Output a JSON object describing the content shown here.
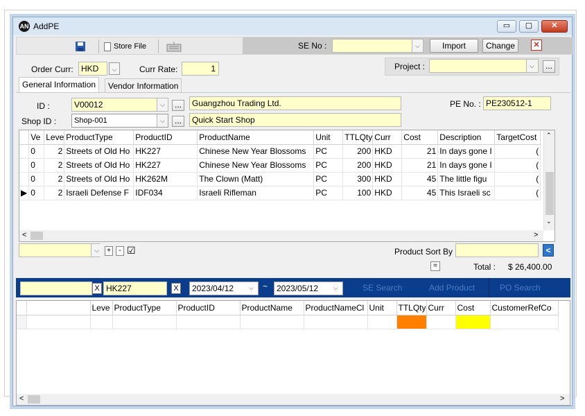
{
  "window": {
    "title": "AddPE",
    "icon_text": "AN",
    "minimize": "▭",
    "maximize": "▢",
    "close": "✕"
  },
  "toolbar": {
    "store_file_label": "Store File",
    "se_no_label": "SE No :",
    "se_no_value": "",
    "import_label": "Import",
    "change_label": "Change",
    "close_label": "✕"
  },
  "header": {
    "order_curr_label": "Order Curr:",
    "order_curr_value": "HKD",
    "curr_rate_label": "Curr Rate:",
    "curr_rate_value": "1",
    "project_label": "Project :",
    "project_value": "",
    "ellipsis": "..."
  },
  "tabs": [
    {
      "label": "General Information"
    },
    {
      "label": "Vendor Information"
    }
  ],
  "general": {
    "id_label": "ID :",
    "id_value": "V00012",
    "vendor_name": "Guangzhou Trading Ltd.",
    "pe_no_label": "PE No. :",
    "pe_no_value": "PE230512-1",
    "shop_id_label": "Shop ID :",
    "shop_id_value": "Shop-001",
    "shop_name": "Quick Start Shop"
  },
  "items_grid": {
    "columns": [
      "Ve",
      "Leve",
      "ProductType",
      "ProductID",
      "ProductName",
      "Unit",
      "TTLQty",
      "Curr",
      "Cost",
      "Description",
      "TargetCost"
    ],
    "rows": [
      {
        "marker": "",
        "ve": "0",
        "leve": "2",
        "type": "Streets of Old Ho",
        "id": "HK227",
        "name": "Chinese New Year Blossoms",
        "unit": "PC",
        "qty": "200",
        "curr": "HKD",
        "cost": "21",
        "desc": "In days gone I",
        "target": "("
      },
      {
        "marker": "",
        "ve": "0",
        "leve": "2",
        "type": "Streets of Old Ho",
        "id": "HK227",
        "name": "Chinese New Year Blossoms",
        "unit": "PC",
        "qty": "200",
        "curr": "HKD",
        "cost": "21",
        "desc": "In days gone I",
        "target": "("
      },
      {
        "marker": "",
        "ve": "0",
        "leve": "2",
        "type": "Streets of Old Ho",
        "id": "HK262M",
        "name": "The Clown (Matt)",
        "unit": "PC",
        "qty": "300",
        "curr": "HKD",
        "cost": "45",
        "desc": "The little figu",
        "target": "("
      },
      {
        "marker": "▶",
        "ve": "0",
        "leve": "2",
        "type": "Israeli Defense F",
        "id": "IDF034",
        "name": "Israeli Rifleman",
        "unit": "PC",
        "qty": "100",
        "curr": "HKD",
        "cost": "45",
        "desc": "This Israeli sc",
        "target": "("
      }
    ]
  },
  "controls": {
    "plus": "+",
    "minus": "-",
    "check": "☑",
    "product_sort_label": "Product Sort By",
    "equals": "=",
    "total_label": "Total :",
    "total_value": "$ 26,400.00"
  },
  "search_bar": {
    "field1_value": "",
    "clear_label": "X",
    "product_value": "HK227",
    "date_from": "2023/04/12",
    "tilde": "~",
    "date_to": "2023/05/12",
    "se_search": "SE Search",
    "add_product": "Add Product",
    "po_search": "PO Search"
  },
  "results_grid": {
    "columns": [
      "Leve",
      "ProductType",
      "ProductID",
      "ProductName",
      "ProductNameCl",
      "Unit",
      "TTLQty",
      "Curr",
      "Cost",
      "CustomerRefCo"
    ]
  },
  "colors": {
    "accent_blue": "#0a3d8c",
    "field_yellow": "#ffffcc",
    "qty_orange": "#ff8000",
    "cost_yellow": "#ffff00"
  }
}
